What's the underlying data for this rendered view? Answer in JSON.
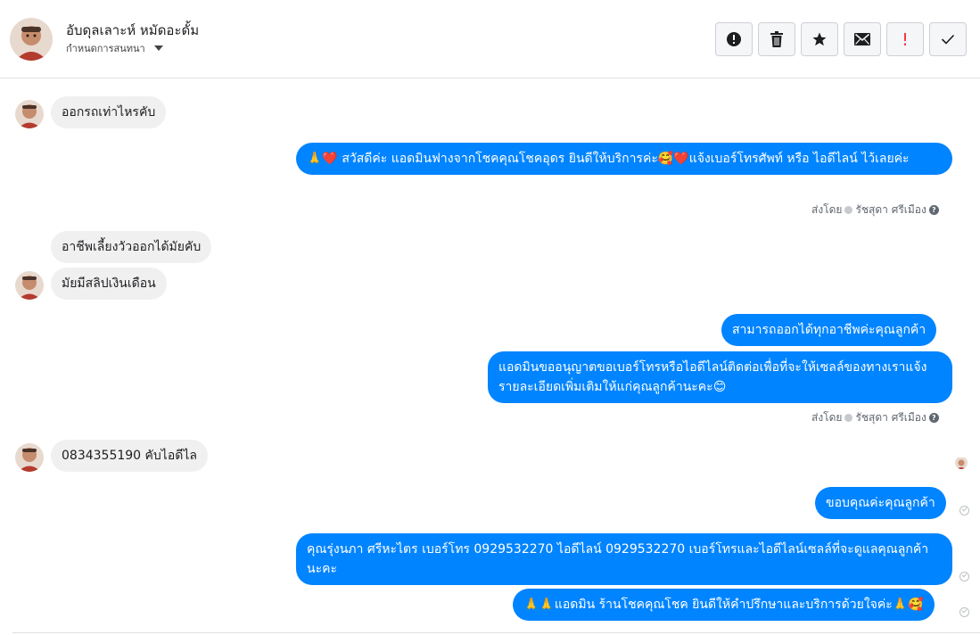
{
  "header": {
    "contact_name": "อับดุลเลาะห์ หมัดอะดั้ม",
    "conversation_settings": "กำหนดการสนทนา",
    "toolbar": [
      {
        "name": "mark-spam-button",
        "icon": "exclamation-circle-icon"
      },
      {
        "name": "delete-button",
        "icon": "trash-icon"
      },
      {
        "name": "star-button",
        "icon": "star-icon"
      },
      {
        "name": "mark-unread-button",
        "icon": "envelope-icon"
      },
      {
        "name": "follow-up-button",
        "icon": "exclamation-icon",
        "color": "#fa383e"
      },
      {
        "name": "mark-done-button",
        "icon": "checkmark-icon"
      }
    ]
  },
  "messages": [
    {
      "from": "customer",
      "text": "ออกรถเท่าไหรคับ"
    },
    {
      "from": "page",
      "text": "🙏❤️ สวัสดีค่ะ แอดมินฟางจากโชคคุณโชคอุดร ยินดีให้บริการค่ะ🥰❤️แจ้งเบอร์โทรศัพท์ หรือ ไอดีไลน์  ไว้เลยค่ะ"
    },
    {
      "from": "customer",
      "text": "อาชีพเลี้ยงวัวออกได้มัยคับ"
    },
    {
      "from": "customer",
      "text": "มัยมีสลิปเงินเดือน"
    },
    {
      "from": "page",
      "text": "สามารถออกได้ทุกอาชีพค่ะคุณลูกค้า"
    },
    {
      "from": "page",
      "text": "แอดมินขออนุญาตขอเบอร์โทรหรือไอดีไลน์ติดต่อเพื่อที่จะให้เซลล์ของทางเราแจ้งรายละเอียดเพิ่มเติมให้แก่คุณลูกค้านะคะ😊"
    },
    {
      "from": "customer",
      "text": "0834355190 คับไอดีไล"
    },
    {
      "from": "page",
      "text": "ขอบคุณค่ะคุณลูกค้า"
    },
    {
      "from": "page",
      "text": "คุณรุ่งนภา ศรีหะไตร       เบอร์โทร 0929532270  ไอดีไลน์ 0929532270   เบอร์โทรและไอดีไลน์เซลล์ที่จะดูแลคุณลูกค้านะคะ"
    },
    {
      "from": "page",
      "text": "🙏🙏แอดมิน ร้านโชคคุณโชค ยินดีให้คำปรึกษาและบริการด้วยใจค่ะ🙏🥰"
    }
  ],
  "sent_by": {
    "prefix": "ส่งโดย",
    "agent": "รัชสุดา ศรีเมือง",
    "help": "?"
  },
  "colors": {
    "outgoing_bubble": "#0084ff",
    "incoming_bubble": "#f1f0f0"
  }
}
